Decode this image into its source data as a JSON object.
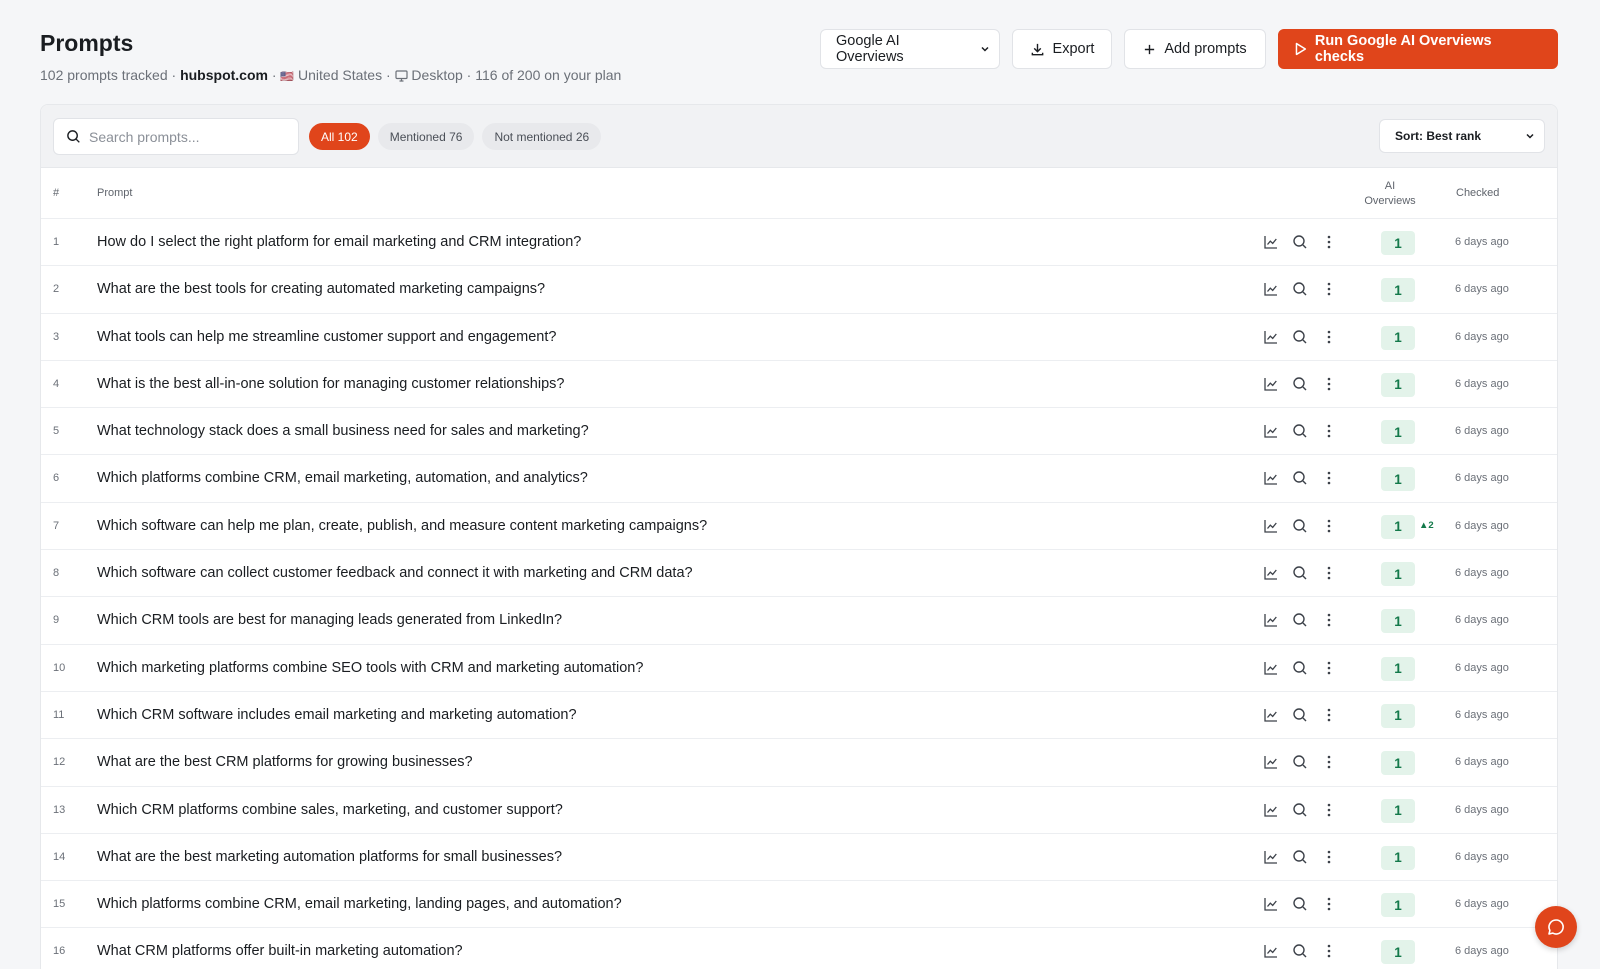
{
  "header": {
    "title": "Prompts",
    "tracked": "102 prompts tracked",
    "separator": "·",
    "domain": "hubspot.com",
    "flag": "🇺🇸",
    "country": "United States",
    "device": "Desktop",
    "plan": "116 of 200 on your plan"
  },
  "actions": {
    "engine_select": "Google AI Overviews",
    "export_label": "Export",
    "add_label": "Add prompts",
    "run_label": "Run Google AI Overviews checks"
  },
  "toolbar": {
    "search_placeholder": "Search prompts...",
    "filters": [
      {
        "label": "All 102",
        "active": true
      },
      {
        "label": "Mentioned 76",
        "active": false
      },
      {
        "label": "Not mentioned 26",
        "active": false
      }
    ],
    "sort_label": "Sort: Best rank"
  },
  "table": {
    "col_num": "#",
    "col_prompt": "Prompt",
    "col_ai_line1": "AI",
    "col_ai_line2": "Overviews",
    "col_checked": "Checked",
    "rows": [
      {
        "num": "1",
        "prompt": "How do I select the right platform for email marketing and CRM integration?",
        "rank": "1",
        "delta": "",
        "checked": "6 days ago"
      },
      {
        "num": "2",
        "prompt": "What are the best tools for creating automated marketing campaigns?",
        "rank": "1",
        "delta": "",
        "checked": "6 days ago"
      },
      {
        "num": "3",
        "prompt": "What tools can help me streamline customer support and engagement?",
        "rank": "1",
        "delta": "",
        "checked": "6 days ago"
      },
      {
        "num": "4",
        "prompt": "What is the best all-in-one solution for managing customer relationships?",
        "rank": "1",
        "delta": "",
        "checked": "6 days ago"
      },
      {
        "num": "5",
        "prompt": "What technology stack does a small business need for sales and marketing?",
        "rank": "1",
        "delta": "",
        "checked": "6 days ago"
      },
      {
        "num": "6",
        "prompt": "Which platforms combine CRM, email marketing, automation, and analytics?",
        "rank": "1",
        "delta": "",
        "checked": "6 days ago"
      },
      {
        "num": "7",
        "prompt": "Which software can help me plan, create, publish, and measure content marketing campaigns?",
        "rank": "1",
        "delta": "▲2",
        "checked": "6 days ago"
      },
      {
        "num": "8",
        "prompt": "Which software can collect customer feedback and connect it with marketing and CRM data?",
        "rank": "1",
        "delta": "",
        "checked": "6 days ago"
      },
      {
        "num": "9",
        "prompt": "Which CRM tools are best for managing leads generated from LinkedIn?",
        "rank": "1",
        "delta": "",
        "checked": "6 days ago"
      },
      {
        "num": "10",
        "prompt": "Which marketing platforms combine SEO tools with CRM and marketing automation?",
        "rank": "1",
        "delta": "",
        "checked": "6 days ago"
      },
      {
        "num": "11",
        "prompt": "Which CRM software includes email marketing and marketing automation?",
        "rank": "1",
        "delta": "",
        "checked": "6 days ago"
      },
      {
        "num": "12",
        "prompt": "What are the best CRM platforms for growing businesses?",
        "rank": "1",
        "delta": "",
        "checked": "6 days ago"
      },
      {
        "num": "13",
        "prompt": "Which CRM platforms combine sales, marketing, and customer support?",
        "rank": "1",
        "delta": "",
        "checked": "6 days ago"
      },
      {
        "num": "14",
        "prompt": "What are the best marketing automation platforms for small businesses?",
        "rank": "1",
        "delta": "",
        "checked": "6 days ago"
      },
      {
        "num": "15",
        "prompt": "Which platforms combine CRM, email marketing, landing pages, and automation?",
        "rank": "1",
        "delta": "",
        "checked": "6 days ago"
      },
      {
        "num": "16",
        "prompt": "What CRM platforms offer built-in marketing automation?",
        "rank": "1",
        "delta": "",
        "checked": "6 days ago"
      }
    ]
  },
  "icons": {
    "search": "search-icon",
    "chart": "trend-chart-icon",
    "inspect": "magnifier-icon",
    "more": "more-vertical-icon",
    "chat": "chat-bubble-icon"
  },
  "colors": {
    "accent": "#e0451b",
    "rank_bg": "#e3f3ea",
    "rank_text": "#13794a"
  }
}
